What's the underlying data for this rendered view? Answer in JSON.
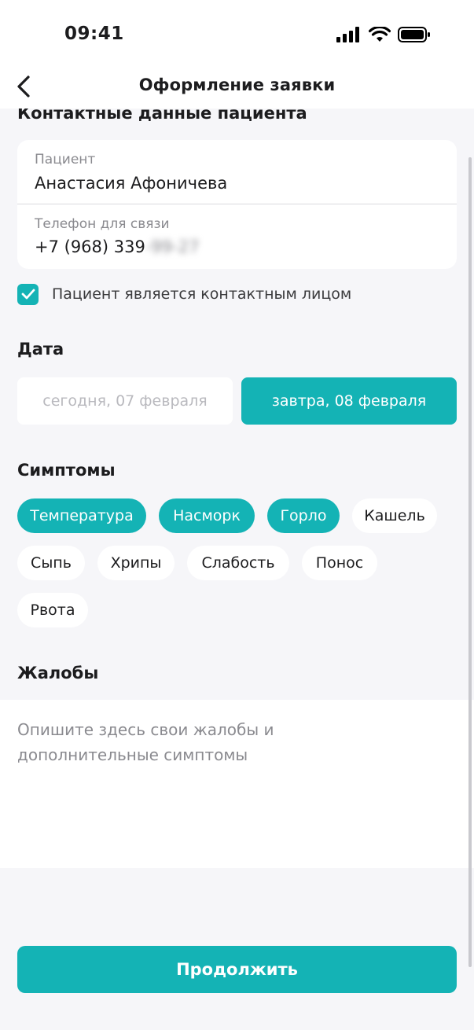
{
  "status_bar": {
    "time": "09:41"
  },
  "nav": {
    "title": "Оформление заявки"
  },
  "contact": {
    "section_title": "Контактные данные пациента",
    "patient_label": "Пациент",
    "patient_value": "Анастасия Афоничева",
    "phone_label": "Телефон для связи",
    "phone_value": "+7 (968) 339",
    "phone_hidden": "-99-27",
    "contact_checkbox_label": "Пациент является контактным лицом",
    "contact_checked": true
  },
  "date": {
    "section_title": "Дата",
    "today_label": "сегодня, 07 февраля",
    "tomorrow_label": "завтра, 08 февраля",
    "selected": "tomorrow"
  },
  "symptoms": {
    "section_title": "Симптомы",
    "chips": [
      {
        "label": "Температура",
        "selected": true
      },
      {
        "label": "Насморк",
        "selected": true
      },
      {
        "label": "Горло",
        "selected": true
      },
      {
        "label": "Кашель",
        "selected": false
      },
      {
        "label": "Сыпь",
        "selected": false
      },
      {
        "label": "Хрипы",
        "selected": false
      },
      {
        "label": "Слабость",
        "selected": false
      },
      {
        "label": "Понос",
        "selected": false
      },
      {
        "label": "Рвота",
        "selected": false
      }
    ]
  },
  "complaints": {
    "section_title": "Жалобы",
    "placeholder": "Опишите здесь свои жалобы и дополнительные симптомы"
  },
  "actions": {
    "continue_label": "Продолжить"
  },
  "colors": {
    "accent": "#14b3b5",
    "background": "#f6f6f9",
    "card": "#ffffff"
  },
  "icons": [
    "signal-icon",
    "wifi-icon",
    "battery-icon",
    "back-arrow-icon",
    "checkmark-icon"
  ]
}
